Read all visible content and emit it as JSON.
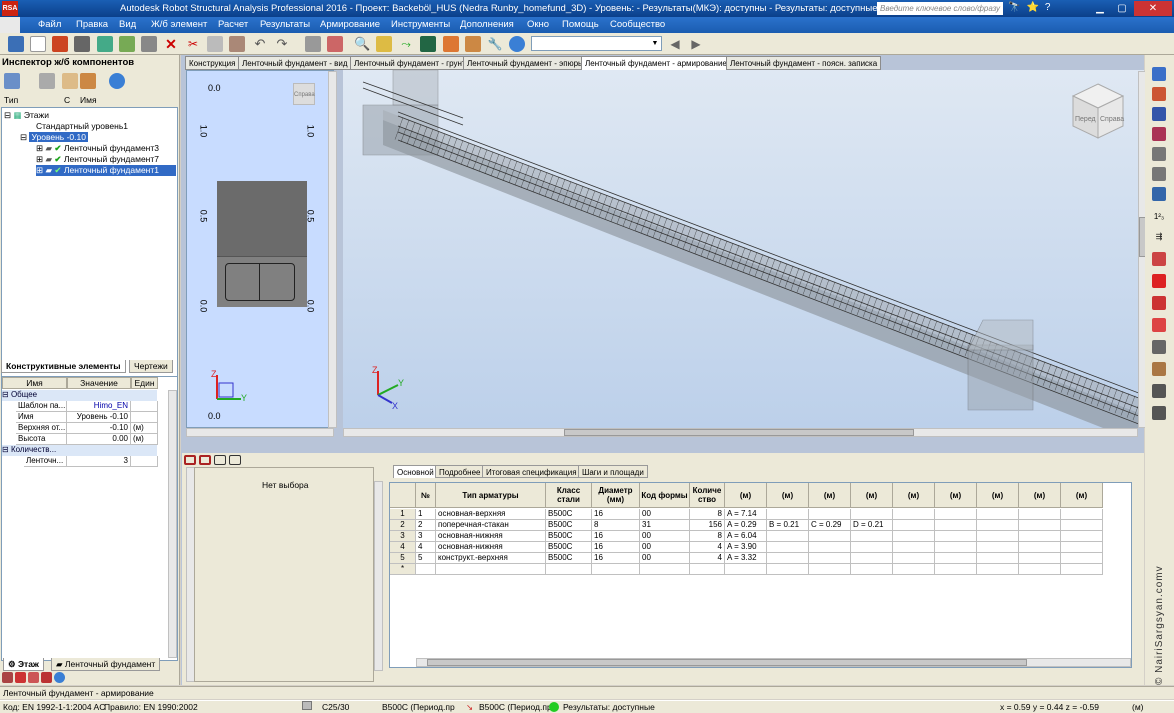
{
  "titlebar": {
    "title": "Autodesk Robot Structural Analysis Professional 2016 - Проект: Backeböl_HUS (Nedra Runby_homefund_3D) - Уровень:  - Результаты(МКЭ): доступны - Результаты: доступные",
    "search_placeholder": "Введите ключевое слово/фразу",
    "logo_text": "RSA"
  },
  "menu": [
    "Файл",
    "Правка",
    "Вид",
    "Ж/б элемент",
    "Расчет",
    "Результаты",
    "Армирование",
    "Инструменты",
    "Дополнения",
    "Окно",
    "Помощь",
    "Сообщество"
  ],
  "inspector": {
    "title": "Инспектор ж/б компонентов",
    "columns": [
      "Тип",
      "С",
      "Имя"
    ],
    "tree": [
      {
        "label": "Этажи",
        "indent": 0,
        "icon": "floors-icon"
      },
      {
        "label": "Стандартный уровень1",
        "indent": 1
      },
      {
        "label": "Уровень -0.10",
        "indent": 1,
        "selected": true
      },
      {
        "label": "Ленточный фундамент3",
        "indent": 2,
        "check": true
      },
      {
        "label": "Ленточный фундамент7",
        "indent": 2,
        "check": true
      },
      {
        "label": "Ленточный фундамент1",
        "indent": 2,
        "check": true,
        "selected": true
      }
    ],
    "tabs": [
      "Конструктивные элементы",
      "Чертежи"
    ],
    "prop_headers": [
      "Имя",
      "Значение",
      "Един"
    ],
    "props": [
      {
        "group": true,
        "name": "Общее"
      },
      {
        "name": "Шаблон па...",
        "value": "Himo_EN",
        "unit": ""
      },
      {
        "name": "Имя",
        "value": "Уровень -0.10",
        "unit": ""
      },
      {
        "name": "Верхняя от...",
        "value": "-0.10",
        "unit": "(м)"
      },
      {
        "name": "Высота",
        "value": "0.00",
        "unit": "(м)"
      },
      {
        "group": true,
        "name": "Количеств..."
      },
      {
        "name": "Ленточн...",
        "value": "3",
        "unit": ""
      }
    ],
    "bottom_tabs": [
      "Этаж",
      "Ленточный фундамент"
    ]
  },
  "view_tabs": [
    "Конструкция",
    "Ленточный фундамент - вид",
    "Ленточный фундамент - грунт",
    "Ленточный фундамент - эпюры",
    "Ленточный фундамент - армирование",
    "Ленточный фундамент - поясн. записка"
  ],
  "view_tabs_active": 4,
  "view2d": {
    "ticks": [
      "0.0",
      "1.0",
      "0.5",
      "0.0",
      "0.0"
    ],
    "ticks_right": [
      "1.0",
      "0.5",
      "0.0"
    ],
    "nav_label": "Справа"
  },
  "view3d": {
    "cube_labels": [
      "Перед",
      "Справа"
    ]
  },
  "lower": {
    "no_selection": "Нет выбора",
    "tabs": [
      "Основной",
      "Подробнее",
      "Итоговая спецификация",
      "Шаги и площади"
    ],
    "headers": [
      "№",
      "Тип арматуры",
      "Класс стали",
      "Диаметр (мм)",
      "Код формы",
      "Количе ство",
      "(м)",
      "(м)",
      "(м)",
      "(м)",
      "(м)",
      "(м)",
      "(м)",
      "(м)",
      "(м)"
    ],
    "rows": [
      {
        "id": "1",
        "n": "1",
        "type": "основная-верхняя",
        "cls": "B500C",
        "d": "16",
        "code": "00",
        "qty": "8",
        "a": "A = 7.14",
        "b": "",
        "c": "",
        "dd": ""
      },
      {
        "id": "2",
        "n": "2",
        "type": "поперечная-стакан",
        "cls": "B500C",
        "d": "8",
        "code": "31",
        "qty": "156",
        "a": "A = 0.29",
        "b": "B = 0.21",
        "c": "C = 0.29",
        "dd": "D = 0.21"
      },
      {
        "id": "3",
        "n": "3",
        "type": "основная-нижняя",
        "cls": "B500C",
        "d": "16",
        "code": "00",
        "qty": "8",
        "a": "A = 6.04",
        "b": "",
        "c": "",
        "dd": ""
      },
      {
        "id": "4",
        "n": "4",
        "type": "основная-нижняя",
        "cls": "B500C",
        "d": "16",
        "code": "00",
        "qty": "4",
        "a": "A = 3.90",
        "b": "",
        "c": "",
        "dd": ""
      },
      {
        "id": "5",
        "n": "5",
        "type": "конструкт.-верхняя",
        "cls": "B500C",
        "d": "16",
        "code": "00",
        "qty": "4",
        "a": "A = 3.32",
        "b": "",
        "c": "",
        "dd": ""
      }
    ],
    "new_row_marker": "*"
  },
  "status": {
    "line1": "Ленточный фундамент - армирование",
    "code": "Код: EN 1992-1-1:2004 AC",
    "rule": "Правило: EN 1990:2002",
    "concrete": "C25/30",
    "steel1": "B500C (Период.пр",
    "steel2": "B500C (Период.пр",
    "results": "Результаты: доступные",
    "coords": "x = 0.59  y = 0.44  z = -0.59",
    "unit": "(м)"
  },
  "watermark": "© NairiSargsyan.comv",
  "colors": {
    "accent": "#316ac5",
    "title": "#0b3f8a",
    "check": "#19a319"
  }
}
